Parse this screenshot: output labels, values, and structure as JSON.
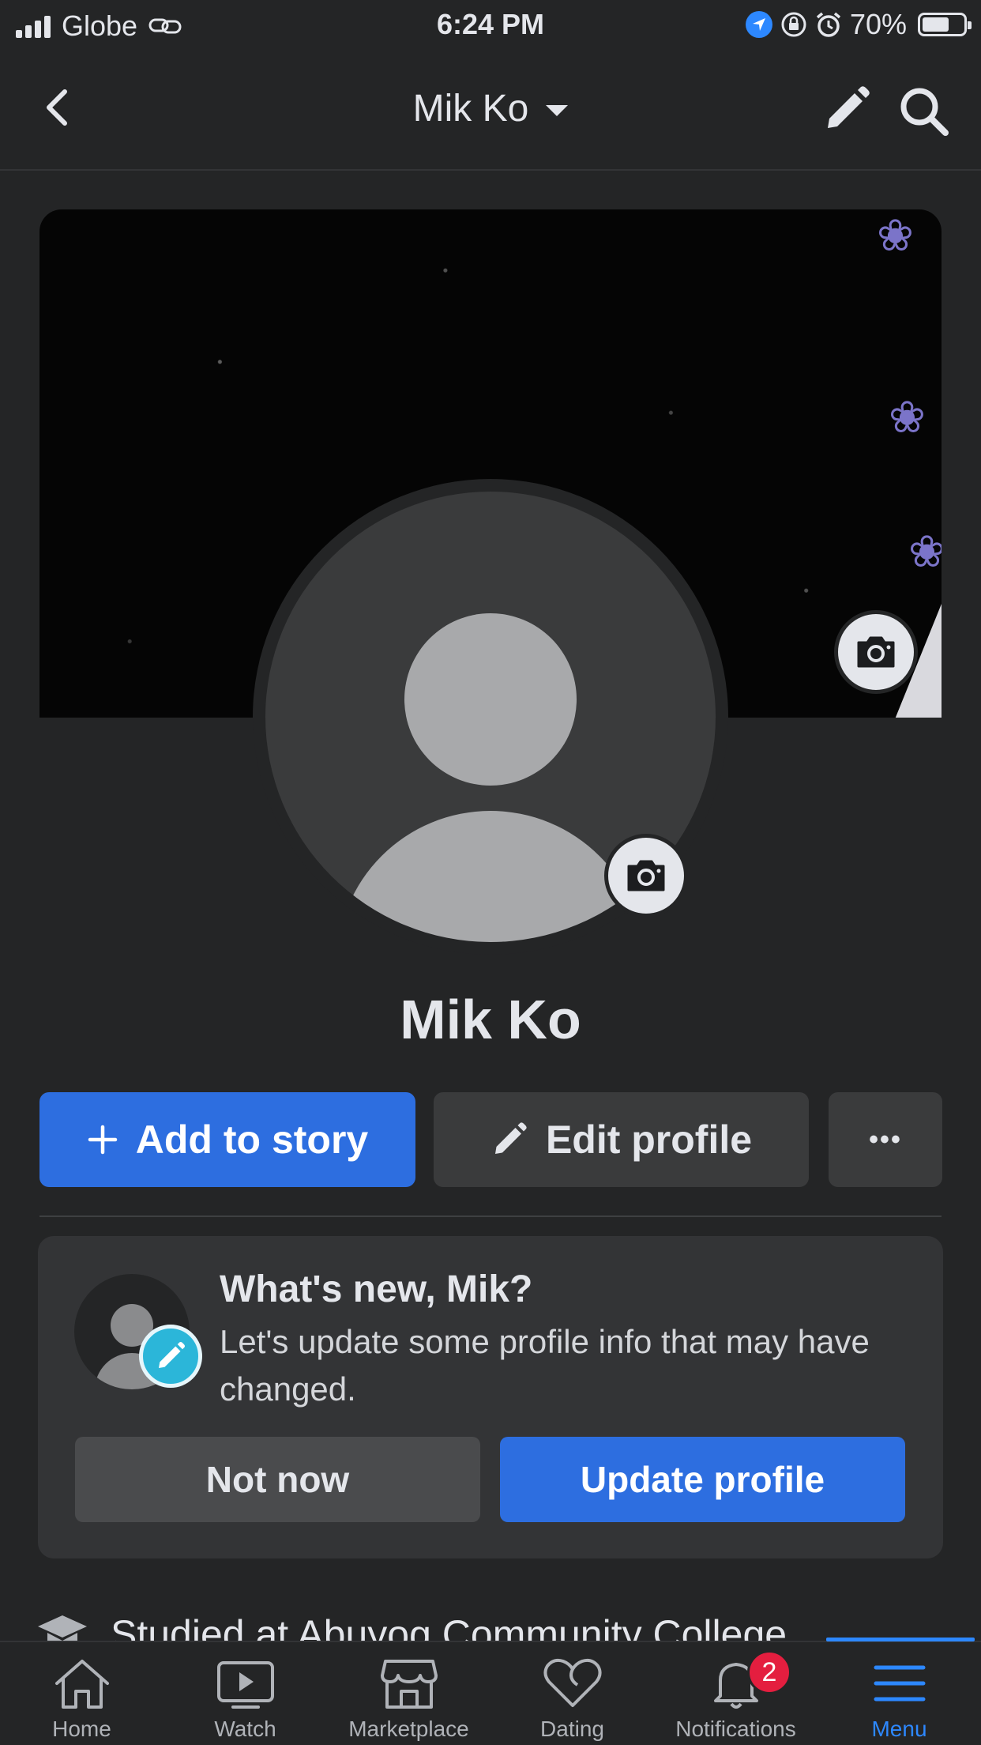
{
  "status_bar": {
    "carrier": "Globe",
    "time": "6:24 PM",
    "battery_percent": "70%",
    "battery_level": 0.7
  },
  "nav": {
    "title": "Mik Ko"
  },
  "profile": {
    "name": "Mik Ko"
  },
  "actions": {
    "add_story": "Add to story",
    "edit_profile": "Edit profile",
    "more": "•••"
  },
  "whats_new_card": {
    "title": "What's new, Mik?",
    "text": "Let's update some profile info that may have changed.",
    "not_now": "Not now",
    "update_profile": "Update profile"
  },
  "intro": {
    "studied": "Studied at Abuyog Community College"
  },
  "tab_bar": {
    "tabs": [
      {
        "label": "Home",
        "icon": "home-icon"
      },
      {
        "label": "Watch",
        "icon": "watch-icon"
      },
      {
        "label": "Marketplace",
        "icon": "marketplace-icon"
      },
      {
        "label": "Dating",
        "icon": "dating-icon"
      },
      {
        "label": "Notifications",
        "icon": "bell-icon",
        "badge": "2"
      },
      {
        "label": "Menu",
        "icon": "menu-icon",
        "active": true
      }
    ]
  },
  "colors": {
    "background": "#242526",
    "accent": "#2d88ff",
    "primary_button": "#2d6ee0",
    "badge": "#e41e3f"
  }
}
